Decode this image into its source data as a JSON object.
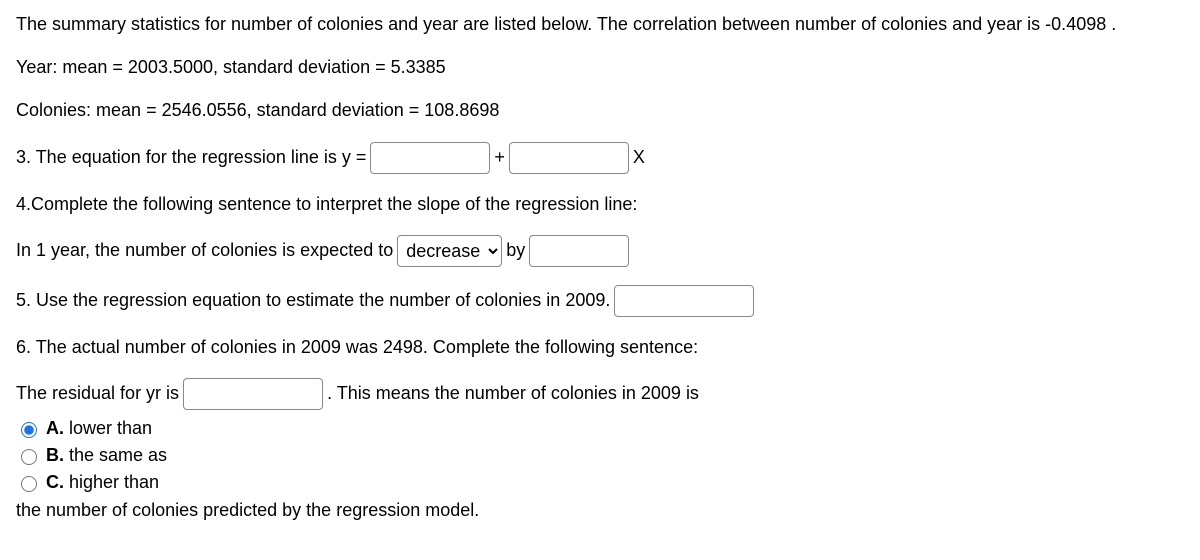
{
  "intro": {
    "summary": "The summary statistics for number of colonies and year are listed below. The correlation between number of colonies and year is -0.4098 .",
    "year_stats": "Year: mean = 2003.5000, standard deviation = 5.3385",
    "colonies_stats": "Colonies: mean = 2546.0556, standard deviation = 108.8698"
  },
  "q3": {
    "prefix": "3. The equation for the regression line is y =",
    "plus": "+",
    "x": "X"
  },
  "q4": {
    "heading": "4.Complete the following sentence to interpret the slope of the regression line:",
    "prefix": "In 1 year, the number of colonies is expected to",
    "dropdown_selected": "decrease",
    "by": "by"
  },
  "q5": {
    "text": "5. Use the regression equation to estimate the number of colonies in 2009."
  },
  "q6": {
    "heading": "6. The actual number of colonies in 2009 was 2498. Complete the following sentence:",
    "prefix": "The residual for yr is",
    "suffix": ". This means the number of colonies in 2009 is",
    "options": {
      "a": {
        "letter": "A.",
        "text": " lower than"
      },
      "b": {
        "letter": "B.",
        "text": " the same as"
      },
      "c": {
        "letter": "C.",
        "text": " higher than"
      }
    },
    "trailing": "the number of colonies predicted by the regression model."
  }
}
